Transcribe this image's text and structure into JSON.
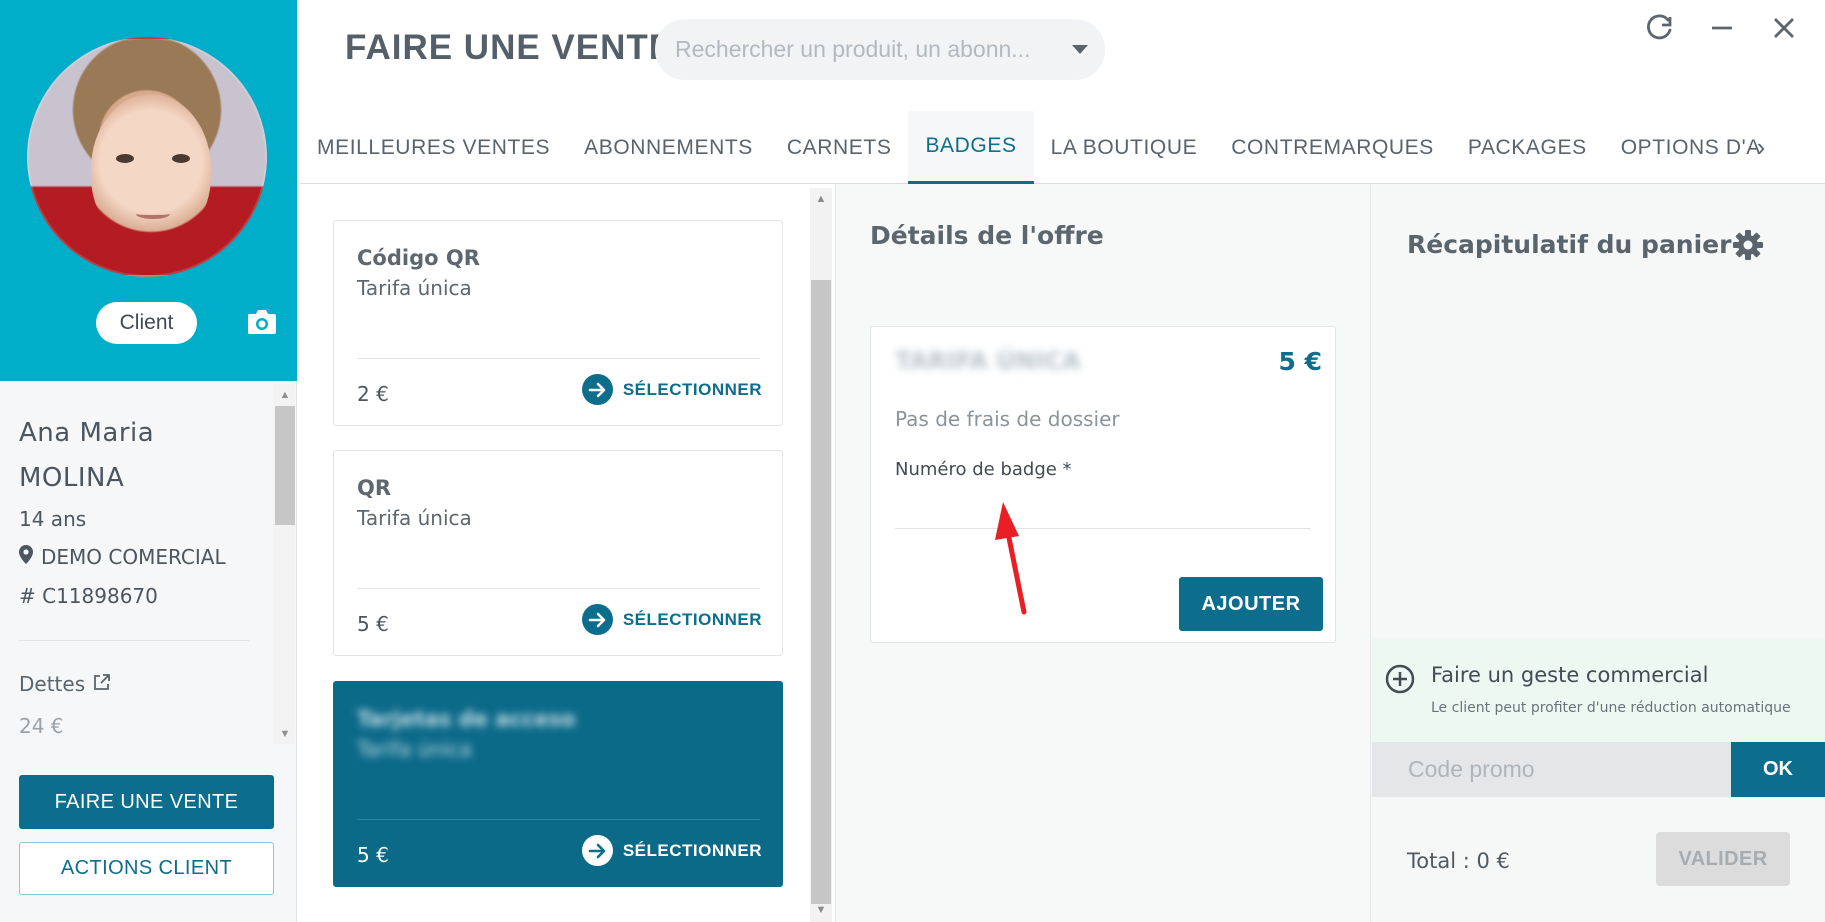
{
  "client": {
    "badge_label": "Client",
    "first_name": "Ana Maria",
    "last_name": "MOLINA",
    "age": "14 ans",
    "site": "DEMO COMERCIAL",
    "id": "# C11898670",
    "debts_label": "Dettes",
    "debts_value": "24 €",
    "sale_button": "FAIRE UNE VENTE",
    "actions_button": "ACTIONS CLIENT"
  },
  "header": {
    "title": "FAIRE UNE VENTE",
    "search_placeholder": "Rechercher un produit, un abonn..."
  },
  "tabs": [
    {
      "label": "MEILLEURES VENTES"
    },
    {
      "label": "ABONNEMENTS"
    },
    {
      "label": "CARNETS"
    },
    {
      "label": "BADGES"
    },
    {
      "label": "LA BOUTIQUE"
    },
    {
      "label": "CONTREMARQUES"
    },
    {
      "label": "PACKAGES"
    },
    {
      "label": "OPTIONS D'AB"
    }
  ],
  "products": [
    {
      "title": "Código QR",
      "subtitle": "Tarifa única",
      "price": "2 €",
      "action": "SÉLECTIONNER"
    },
    {
      "title": "QR",
      "subtitle": "Tarifa única",
      "price": "5 €",
      "action": "SÉLECTIONNER"
    },
    {
      "title": "Tarjetas de acceso",
      "subtitle": "Tarifa única",
      "price": "5 €",
      "action": "SÉLECTIONNER"
    }
  ],
  "offer": {
    "heading": "Détails de l'offre",
    "name": "TARIFA ÚNICA",
    "price": "5 €",
    "note": "Pas de frais de dossier",
    "badge_label": "Numéro de badge *",
    "add_button": "AJOUTER"
  },
  "cart": {
    "title": "Récapitulatif du panier",
    "discount_title": "Faire un geste commercial",
    "discount_subtitle": "Le client peut profiter d'une réduction automatique",
    "promo_placeholder": "Code promo",
    "promo_button": "OK",
    "total": "Total : 0 €",
    "validate_button": "VALIDER"
  },
  "colors": {
    "primary": "#0c6d8c",
    "client_header": "#00aec9",
    "annotation_arrow": "#e81f24"
  }
}
